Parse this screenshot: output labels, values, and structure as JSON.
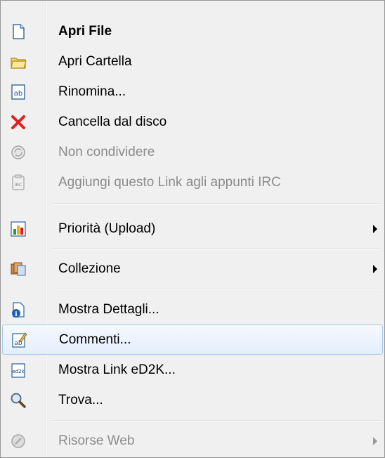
{
  "menu": {
    "items": [
      {
        "label": "Apri File",
        "icon": "blank-file-icon",
        "enabled": true
      },
      {
        "label": "Apri Cartella",
        "icon": "folder-icon",
        "enabled": true
      },
      {
        "label": "Rinomina...",
        "icon": "rename-ab-icon",
        "enabled": true
      },
      {
        "label": "Cancella dal disco",
        "icon": "delete-x-icon",
        "enabled": true
      },
      {
        "label": "Non condividere",
        "icon": "unshare-icon",
        "enabled": false
      },
      {
        "label": "Aggiungi questo Link agli appunti IRC",
        "icon": "irc-clipboard-icon",
        "enabled": false
      },
      {
        "label": "Priorità (Upload)",
        "icon": "priority-bars-icon",
        "enabled": true,
        "submenu": true
      },
      {
        "label": "Collezione",
        "icon": "collection-icon",
        "enabled": true,
        "submenu": true
      },
      {
        "label": "Mostra Dettagli...",
        "icon": "details-icon",
        "enabled": true
      },
      {
        "label": "Commenti...",
        "icon": "comment-icon",
        "enabled": true,
        "highlighted": true
      },
      {
        "label": "Mostra Link eD2K...",
        "icon": "ed2k-link-icon",
        "enabled": true
      },
      {
        "label": "Trova...",
        "icon": "magnifier-icon",
        "enabled": true
      },
      {
        "label": "Risorse Web",
        "icon": "web-resources-icon",
        "enabled": false,
        "submenu": true
      }
    ],
    "colors": {
      "highlight_border": "#a8c8ee",
      "disabled_text": "#8c8c8c",
      "delete_red": "#e02020"
    }
  }
}
